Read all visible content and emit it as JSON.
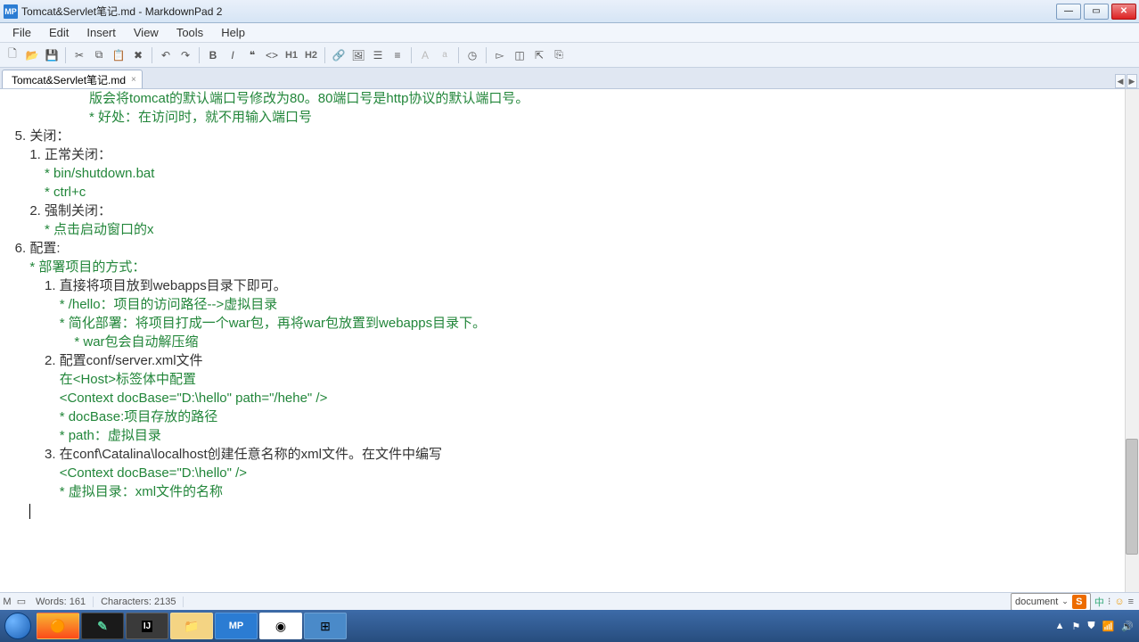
{
  "window": {
    "app_badge": "MP",
    "title": "Tomcat&Servlet笔记.md - MarkdownPad 2"
  },
  "menu": [
    "File",
    "Edit",
    "Insert",
    "View",
    "Tools",
    "Help"
  ],
  "tab": {
    "label": "Tomcat&Servlet笔记.md",
    "close": "×"
  },
  "toolbar_h1": "H1",
  "toolbar_h2": "H2",
  "toolbar_a": "a",
  "toolbar_A": "A",
  "content": {
    "l1a": "                        ",
    "l1b": "版会将tomcat的默认端口号修改为80。80端口号是http协议的默认端口号。",
    "l2a": "                        ",
    "l2b": "* 好处：在访问时，就不用输入端口号",
    "l3": "    5. 关闭：",
    "l4": "        1. 正常关闭：",
    "l5a": "            ",
    "l5b": "* bin/shutdown.bat",
    "l6a": "            ",
    "l6b": "* ctrl+c",
    "l7": "        2. 强制关闭：",
    "l8a": "            ",
    "l8b": "* 点击启动窗口的x",
    "l9": "    6. 配置:",
    "l10a": "        ",
    "l10b": "* 部署项目的方式：",
    "l11": "            1. 直接将项目放到webapps目录下即可。",
    "l12a": "                ",
    "l12b": "* /hello：项目的访问路径-->虚拟目录",
    "l13a": "                ",
    "l13b": "* 简化部署：将项目打成一个war包，再将war包放置到webapps目录下。",
    "l14a": "                    ",
    "l14b": "* war包会自动解压缩",
    "l15": "",
    "l16": "            2. 配置conf/server.xml文件",
    "l17a": "                ",
    "l17b": "在<Host>标签体中配置",
    "l18a": "                ",
    "l18b": "<Context docBase=\"D:\\hello\" path=\"/hehe\" />",
    "l19a": "                ",
    "l19b": "* docBase:项目存放的路径",
    "l20a": "                ",
    "l20b": "* path：虚拟目录",
    "l21": "",
    "l22": "            3. 在conf\\Catalina\\localhost创建任意名称的xml文件。在文件中编写",
    "l23a": "                ",
    "l23b": "<Context docBase=\"D:\\hello\" />",
    "l24a": "                ",
    "l24b": "* 虚拟目录：xml文件的名称",
    "l25": "",
    "l26": "        "
  },
  "status": {
    "words_label": "Words:",
    "words": "161",
    "chars_label": "Characters:",
    "chars": "2135"
  },
  "ime": {
    "doc": "document"
  },
  "tray_icons": [
    "中",
    "⁝",
    "☺",
    "≡"
  ]
}
